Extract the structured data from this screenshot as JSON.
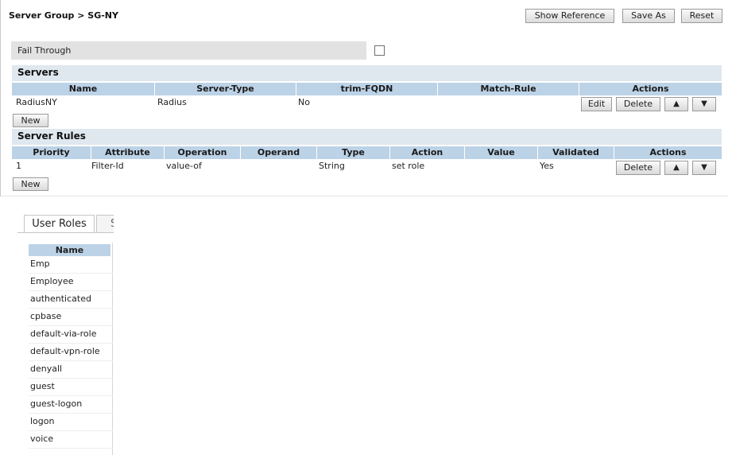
{
  "breadcrumb": "Server Group > SG-NY",
  "header_buttons": {
    "show_reference": "Show Reference",
    "save_as": "Save As",
    "reset": "Reset"
  },
  "fail_through": {
    "label": "Fail Through",
    "checked": false
  },
  "servers": {
    "title": "Servers",
    "columns": [
      "Name",
      "Server-Type",
      "trim-FQDN",
      "Match-Rule",
      "Actions"
    ],
    "rows": [
      {
        "name": "RadiusNY",
        "server_type": "Radius",
        "trim_fqdn": "No",
        "match_rule": ""
      }
    ],
    "edit_label": "Edit",
    "delete_label": "Delete",
    "up_label": "▲",
    "down_label": "▼",
    "new_label": "New"
  },
  "server_rules": {
    "title": "Server Rules",
    "columns": [
      "Priority",
      "Attribute",
      "Operation",
      "Operand",
      "Type",
      "Action",
      "Value",
      "Validated",
      "Actions"
    ],
    "rows": [
      {
        "priority": "1",
        "attribute": "Filter-Id",
        "operation": "value-of",
        "operand": "",
        "type": "String",
        "action": "set role",
        "value": "",
        "validated": "Yes"
      }
    ],
    "delete_label": "Delete",
    "up_label": "▲",
    "down_label": "▼",
    "new_label": "New"
  },
  "lower_tabs": {
    "active": "User Roles",
    "next_partial": "S"
  },
  "user_roles": {
    "column": "Name",
    "items": [
      "Emp",
      "Employee",
      "authenticated",
      "cpbase",
      "default-via-role",
      "default-vpn-role",
      "denyall",
      "guest",
      "guest-logon",
      "logon",
      "voice"
    ]
  }
}
